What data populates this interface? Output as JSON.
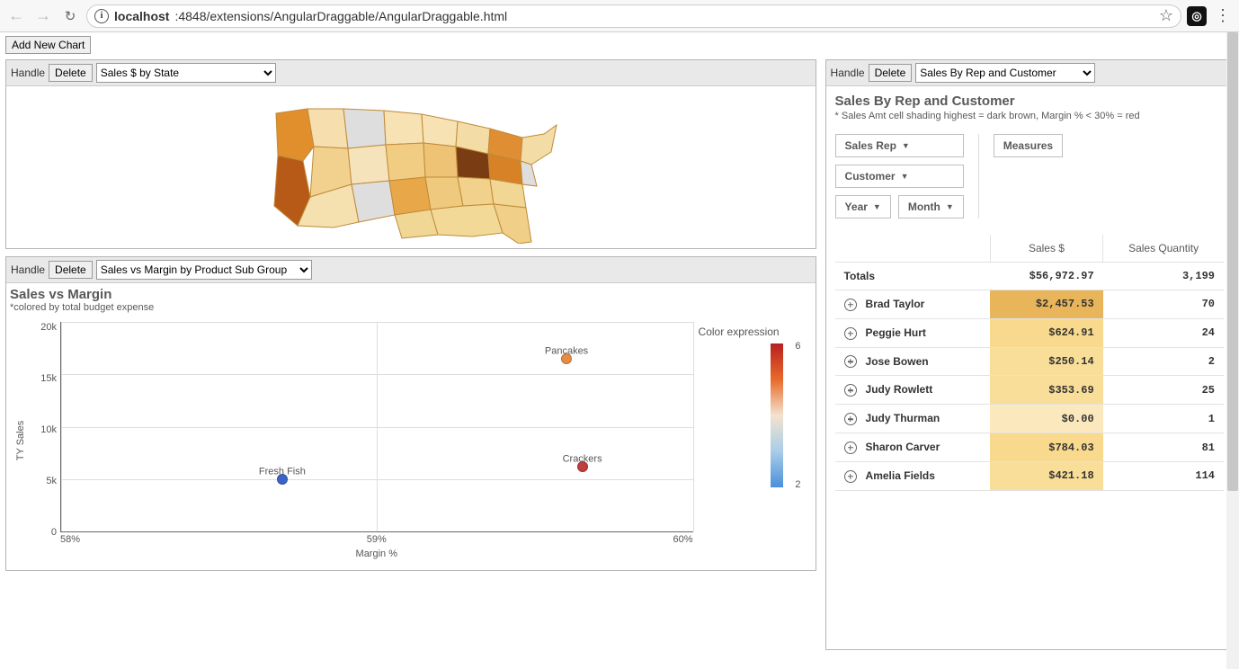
{
  "chrome": {
    "url_host": "localhost",
    "url_path": ":4848/extensions/AngularDraggable/AngularDraggable.html"
  },
  "toolbar": {
    "add_chart_label": "Add New Chart"
  },
  "card_left_top": {
    "handle_label": "Handle",
    "delete_label": "Delete",
    "select_value": "Sales $ by State"
  },
  "card_left_bottom": {
    "handle_label": "Handle",
    "delete_label": "Delete",
    "select_value": "Sales vs Margin by Product Sub Group",
    "title": "Sales vs Margin",
    "subtitle": "*colored by total budget expense",
    "y_label": "TY Sales",
    "x_label": "Margin %",
    "y_ticks": [
      "20k",
      "15k",
      "10k",
      "5k",
      "0"
    ],
    "x_ticks": [
      "58%",
      "59%",
      "60%"
    ],
    "legend_title": "Color expression",
    "legend_max": "6",
    "legend_min": "2"
  },
  "card_right": {
    "handle_label": "Handle",
    "delete_label": "Delete",
    "select_value": "Sales By Rep and Customer",
    "title": "Sales By Rep and Customer",
    "subtitle": "* Sales Amt cell shading highest = dark brown, Margin % < 30% = red",
    "dim_sales_rep": "Sales Rep",
    "dim_customer": "Customer",
    "dim_year": "Year",
    "dim_month": "Month",
    "measures_label": "Measures",
    "col_sales": "Sales $",
    "col_qty": "Sales Quantity",
    "totals_label": "Totals",
    "totals_sales": "$56,972.97",
    "totals_qty": "3,199",
    "rows": [
      {
        "name": "Brad Taylor",
        "sales": "$2,457.53",
        "qty": "70",
        "shade": "cell-shade-1"
      },
      {
        "name": "Peggie Hurt",
        "sales": "$624.91",
        "qty": "24",
        "shade": "cell-shade-2"
      },
      {
        "name": "Jose Bowen",
        "sales": "$250.14",
        "qty": "2",
        "shade": "cell-shade-3"
      },
      {
        "name": "Judy Rowlett",
        "sales": "$353.69",
        "qty": "25",
        "shade": "cell-shade-3"
      },
      {
        "name": "Judy Thurman",
        "sales": "$0.00",
        "qty": "1",
        "shade": "cell-shade-light"
      },
      {
        "name": "Sharon Carver",
        "sales": "$784.03",
        "qty": "81",
        "shade": "cell-shade-2"
      },
      {
        "name": "Amelia Fields",
        "sales": "$421.18",
        "qty": "114",
        "shade": "cell-shade-3"
      }
    ]
  },
  "chart_data": [
    {
      "type": "scatter",
      "title": "Sales vs Margin",
      "xlabel": "Margin %",
      "ylabel": "TY Sales",
      "xlim": [
        58,
        60
      ],
      "ylim": [
        0,
        20000
      ],
      "color_scale": {
        "label": "Color expression",
        "min": 2,
        "max": 6
      },
      "points": [
        {
          "label": "Fresh Fish",
          "x": 58.7,
          "y": 5000,
          "color_value": 2,
          "color": "#3d63c7"
        },
        {
          "label": "Pancakes",
          "x": 59.6,
          "y": 16500,
          "color_value": 5,
          "color": "#e88c43"
        },
        {
          "label": "Crackers",
          "x": 59.65,
          "y": 6200,
          "color_value": 6,
          "color": "#c23d3d"
        }
      ]
    },
    {
      "type": "table",
      "title": "Sales By Rep and Customer",
      "columns": [
        "Sales Rep",
        "Sales $",
        "Sales Quantity"
      ],
      "totals": {
        "Sales $": 56972.97,
        "Sales Quantity": 3199
      },
      "rows": [
        {
          "Sales Rep": "Brad Taylor",
          "Sales $": 2457.53,
          "Sales Quantity": 70
        },
        {
          "Sales Rep": "Peggie Hurt",
          "Sales $": 624.91,
          "Sales Quantity": 24
        },
        {
          "Sales Rep": "Jose Bowen",
          "Sales $": 250.14,
          "Sales Quantity": 2
        },
        {
          "Sales Rep": "Judy Rowlett",
          "Sales $": 353.69,
          "Sales Quantity": 25
        },
        {
          "Sales Rep": "Judy Thurman",
          "Sales $": 0.0,
          "Sales Quantity": 1
        },
        {
          "Sales Rep": "Sharon Carver",
          "Sales $": 784.03,
          "Sales Quantity": 81
        },
        {
          "Sales Rep": "Amelia Fields",
          "Sales $": 421.18,
          "Sales Quantity": 114
        }
      ]
    }
  ]
}
